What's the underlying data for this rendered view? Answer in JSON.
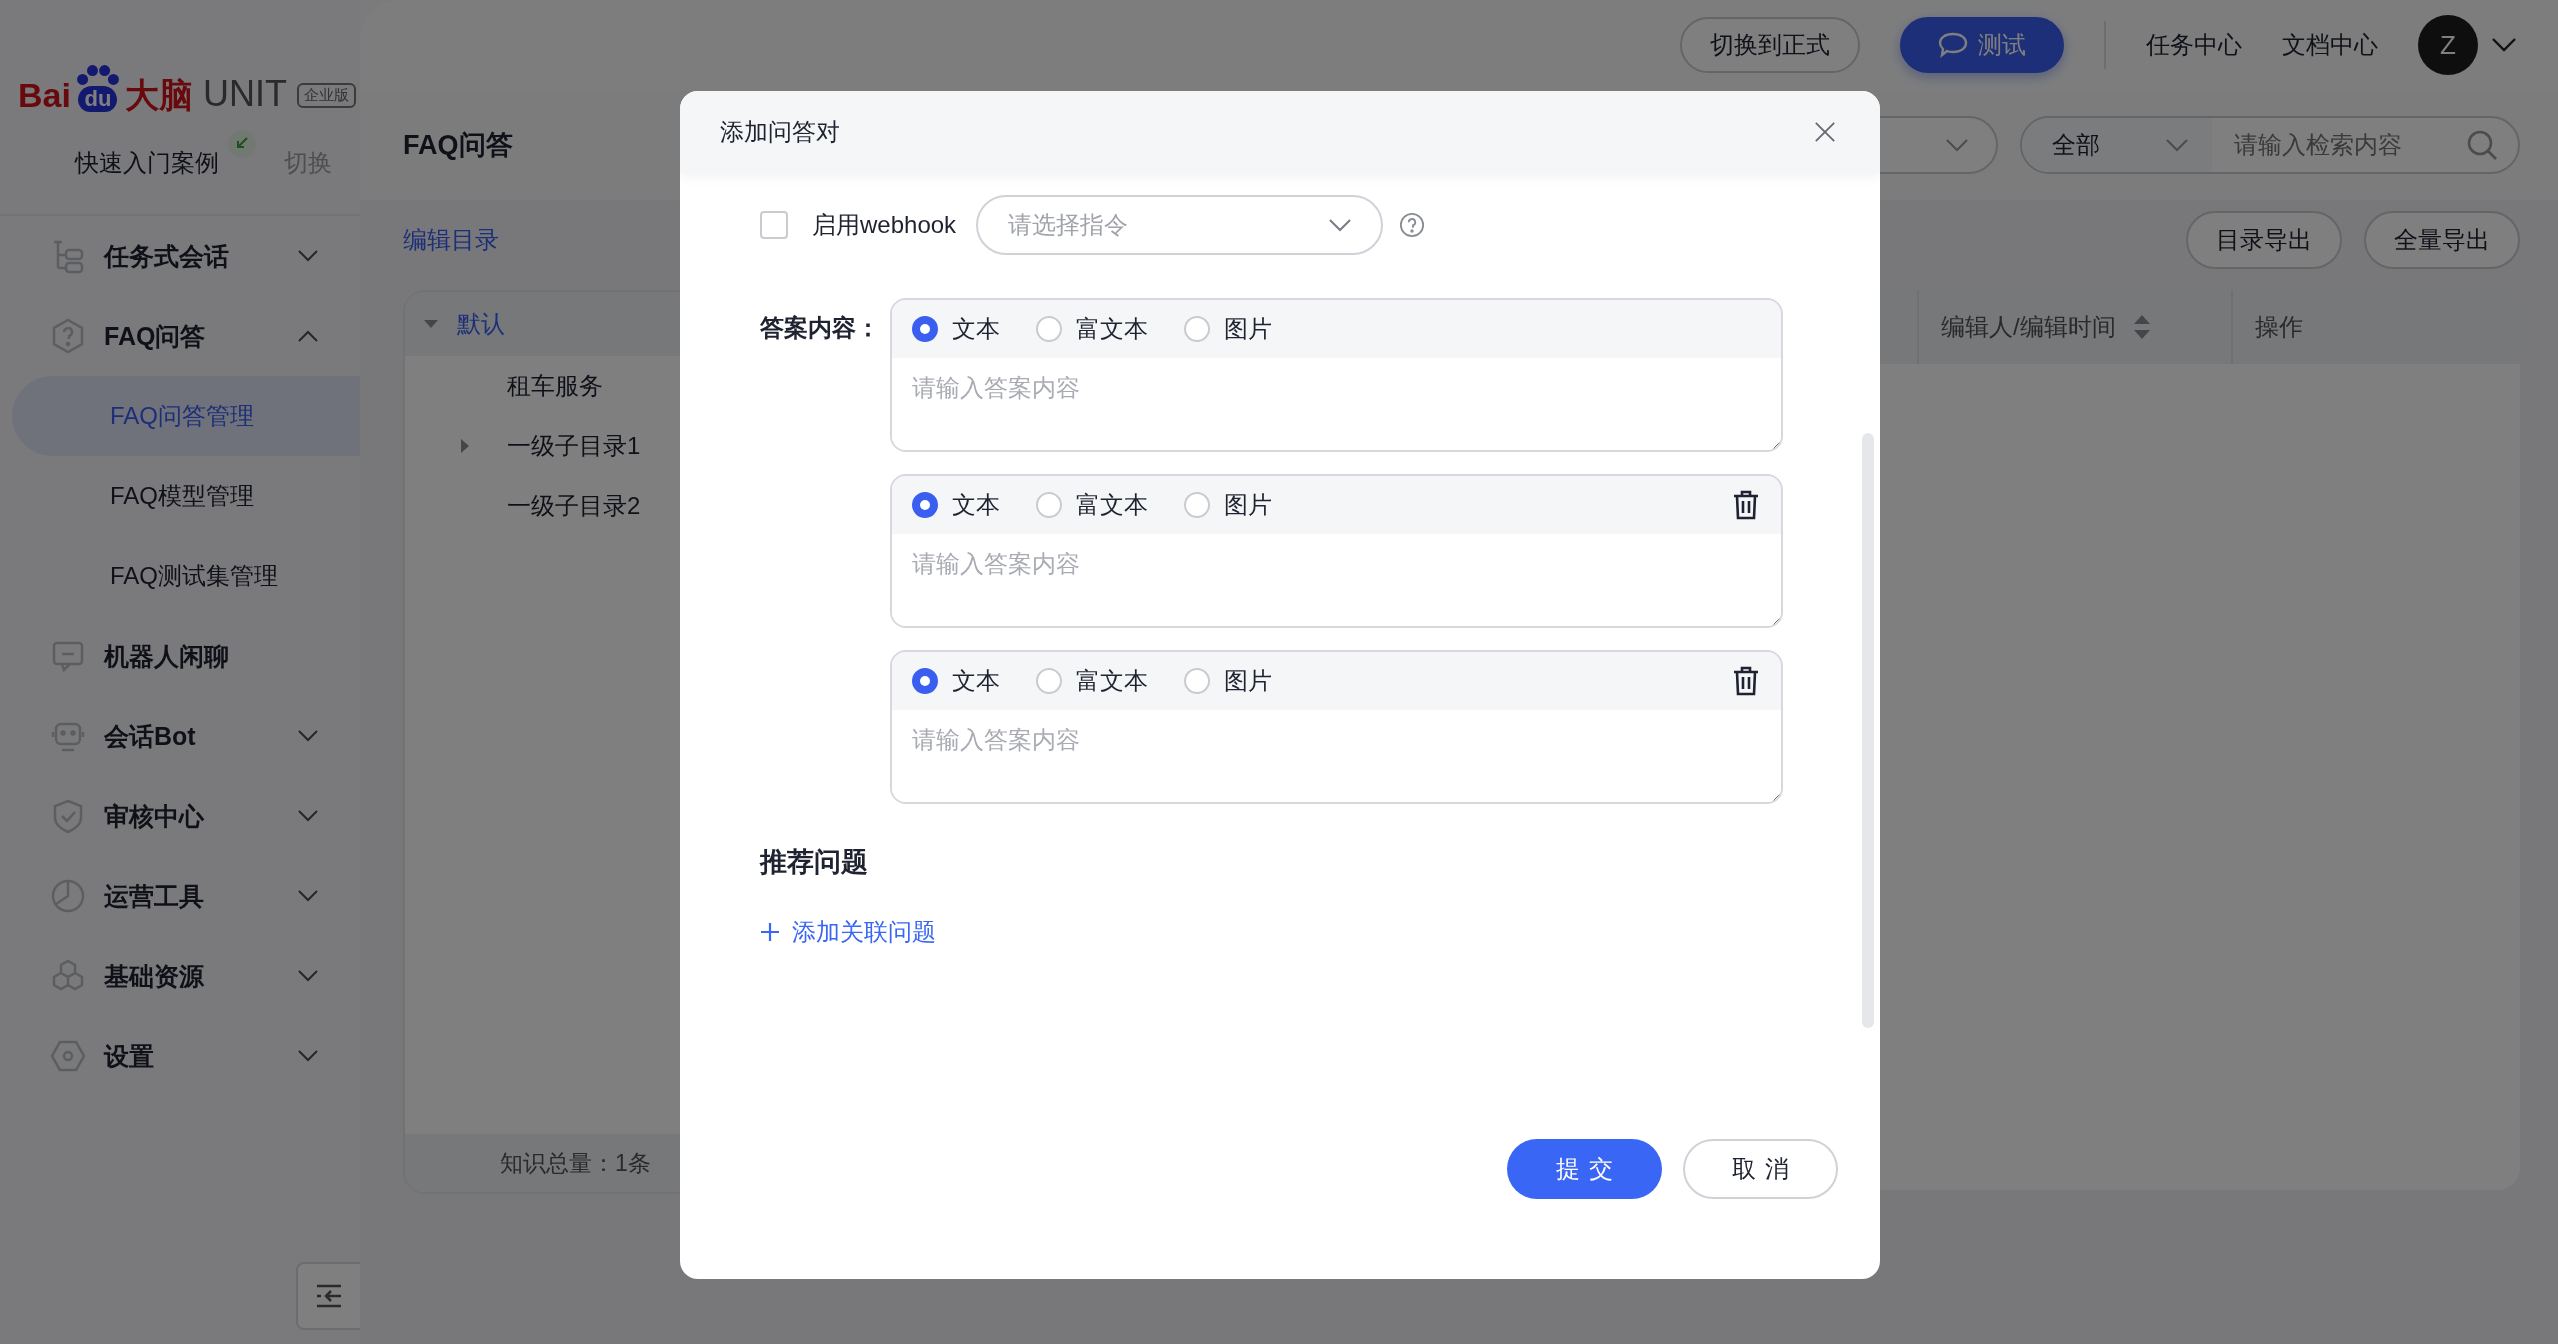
{
  "sidebar": {
    "logo": {
      "brand": "Bai",
      "paw": "du",
      "brain": "大脑",
      "product": "UNIT",
      "edition": "企业版"
    },
    "quick_start": {
      "label": "快速入门案例",
      "switch": "切换"
    },
    "menu": [
      {
        "label": "任务式会话",
        "kind": "group",
        "expanded": false
      },
      {
        "label": "FAQ问答",
        "kind": "group",
        "expanded": true,
        "children": [
          {
            "label": "FAQ问答管理",
            "selected": true
          },
          {
            "label": "FAQ模型管理",
            "selected": false
          },
          {
            "label": "FAQ测试集管理",
            "selected": false
          }
        ]
      },
      {
        "label": "机器人闲聊",
        "kind": "link"
      },
      {
        "label": "会话Bot",
        "kind": "group",
        "expanded": false
      },
      {
        "label": "审核中心",
        "kind": "group",
        "expanded": false
      },
      {
        "label": "运营工具",
        "kind": "group",
        "expanded": false
      },
      {
        "label": "基础资源",
        "kind": "group",
        "expanded": false
      },
      {
        "label": "设置",
        "kind": "group",
        "expanded": false
      }
    ]
  },
  "header": {
    "switch_button": "切换到正式",
    "test_button": "测试",
    "links": [
      "任务中心",
      "文档中心"
    ],
    "avatar": "Z"
  },
  "toolbar": {
    "page_title": "FAQ问答",
    "filter": "全部",
    "search_placeholder": "请输入检索内容",
    "edit_catalog": "编辑目录",
    "export_buttons": [
      "目录导出",
      "全量导出"
    ]
  },
  "tree": {
    "nodes": [
      {
        "label": "默认",
        "selected": true,
        "expanded": true,
        "children": [
          {
            "label": "租车服务",
            "selected": false
          },
          {
            "label": "一级子目录1",
            "selected": false,
            "expanded": false
          },
          {
            "label": "一级子目录2",
            "selected": false
          }
        ]
      }
    ],
    "total": "知识总量：1条"
  },
  "table": {
    "columns": [
      {
        "label": "编辑人/编辑时间",
        "sortable": true
      },
      {
        "label": "操作",
        "sortable": false
      }
    ]
  },
  "modal": {
    "title": "添加问答对",
    "webhook": {
      "label": "启用webhook",
      "checked": false,
      "select_placeholder": "请选择指令"
    },
    "answer_label": "答案内容：",
    "answers": [
      {
        "deletable": false,
        "placeholder": "请输入答案内容",
        "options": [
          {
            "label": "文本",
            "selected": true
          },
          {
            "label": "富文本",
            "selected": false
          },
          {
            "label": "图片",
            "selected": false
          }
        ]
      },
      {
        "deletable": true,
        "placeholder": "请输入答案内容",
        "options": [
          {
            "label": "文本",
            "selected": true
          },
          {
            "label": "富文本",
            "selected": false
          },
          {
            "label": "图片",
            "selected": false
          }
        ]
      },
      {
        "deletable": true,
        "placeholder": "请输入答案内容",
        "options": [
          {
            "label": "文本",
            "selected": true
          },
          {
            "label": "富文本",
            "selected": false
          },
          {
            "label": "图片",
            "selected": false
          }
        ]
      }
    ],
    "recommend_title": "推荐问题",
    "add_related": "添加关联问题",
    "submit": "提交",
    "cancel": "取消"
  }
}
